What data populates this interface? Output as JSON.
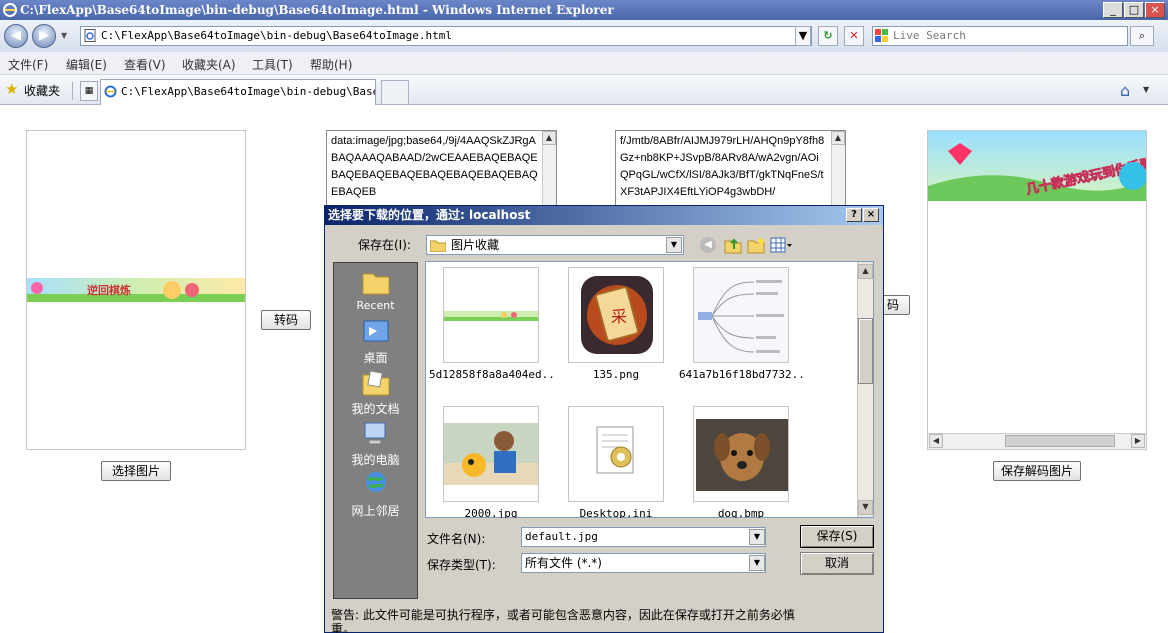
{
  "window": {
    "title": "C:\\FlexApp\\Base64toImage\\bin-debug\\Base64toImage.html - Windows Internet Explorer",
    "minimize": "_",
    "maximize": "□",
    "close": "×"
  },
  "navbar": {
    "back": "◀",
    "forward": "▶",
    "address": "C:\\FlexApp\\Base64toImage\\bin-debug\\Base64toImage.html",
    "search_placeholder": "Live Search"
  },
  "menu": [
    "文件(F)",
    "编辑(E)",
    "查看(V)",
    "收藏夹(A)",
    "工具(T)",
    "帮助(H)"
  ],
  "favorites": {
    "label": "收藏夹"
  },
  "tab": {
    "title": "C:\\FlexApp\\Base64toImage\\bin-debug\\Base64..."
  },
  "page": {
    "left_button": "选择图片",
    "encode_button": "转码",
    "decode_button_partial": "码",
    "save_button": "保存解码图片",
    "left_banner_text": "逆回棋炼",
    "right_banner_text": "几十款游戏玩到你手酸",
    "textarea1": "data:image/jpg;base64,/9j/4AAQSkZJRgABAQAAAQABAAD/2wCEAAEBAQEBAQEBAQEBAQEBAQEBAQEBAQEBAQEBAQEBAQEB",
    "textarea2": "f/Jmtb/8ABfr/AIJMJ979rLH/AHQn9pY8fh8Gz+nb8KP+JSvpB/8ARv8A/wA2vgn/AOiQPqGL/wCfX/lSI/8AJk3/BfT/gkTNqFneS/tXF3tAPJIX4EftLYiOP4g3wbDH/"
  },
  "dialog": {
    "title": "选择要下载的位置，通过: localhost",
    "help": "?",
    "close": "×",
    "save_in_label": "保存在(I):",
    "save_in_value": "图片收藏",
    "places": [
      "Recent",
      "桌面",
      "我的文档",
      "我的电脑",
      "网上邻居"
    ],
    "files": [
      {
        "name": "5d12858f8a8a404ed...",
        "icon": "banner-image"
      },
      {
        "name": "135.png",
        "icon": "scroll-image"
      },
      {
        "name": "641a7b16f18bd7732...",
        "icon": "mindmap-image"
      },
      {
        "name": "2000.jpg",
        "icon": "kid-image"
      },
      {
        "name": "Desktop.ini",
        "icon": "settings-file-icon"
      },
      {
        "name": "dog.bmp",
        "icon": "dog-image"
      }
    ],
    "filename_label": "文件名(N):",
    "filename_value": "default.jpg",
    "filetype_label": "保存类型(T):",
    "filetype_value": "所有文件 (*.*)",
    "save_button": "保存(S)",
    "cancel_button": "取消",
    "warning": "警告: 此文件可能是可执行程序，或者可能包含恶意内容，因此在保存或打开之前务必慎重。"
  }
}
